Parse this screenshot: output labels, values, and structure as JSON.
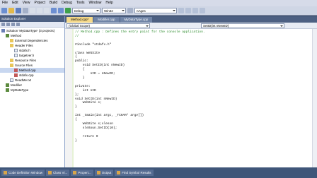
{
  "menu": [
    "File",
    "Edit",
    "View",
    "Project",
    "Build",
    "Debug",
    "Tools",
    "Window",
    "Help"
  ],
  "toolbar": {
    "config": "Debug",
    "platform": "Win32",
    "find": "nAges"
  },
  "solution_explorer": {
    "title": "Solution Explorer",
    "items": [
      {
        "label": "Solution 'MyDataType' (3 projects)",
        "kind": "sol",
        "indent": 0
      },
      {
        "label": "Method",
        "kind": "proj",
        "indent": 1
      },
      {
        "label": "External Dependencies",
        "kind": "folder",
        "indent": 2
      },
      {
        "label": "Header Files",
        "kind": "folder",
        "indent": 2
      },
      {
        "label": "stdafx.h",
        "kind": "file",
        "indent": 3
      },
      {
        "label": "targetver.h",
        "kind": "file",
        "indent": 3
      },
      {
        "label": "Resource Files",
        "kind": "folder",
        "indent": 2
      },
      {
        "label": "Source Files",
        "kind": "folder",
        "indent": 2
      },
      {
        "label": "Method.cpp",
        "kind": "cpp",
        "indent": 3
      },
      {
        "label": "stdafx.cpp",
        "kind": "cpp",
        "indent": 3
      },
      {
        "label": "ReadMe.txt",
        "kind": "file",
        "indent": 2
      },
      {
        "label": "Modifier",
        "kind": "proj",
        "indent": 1
      },
      {
        "label": "MyDataType",
        "kind": "proj",
        "indent": 1
      }
    ]
  },
  "tabs": [
    "Method.cpp*",
    "Modifier.cpp",
    "MyDataType.cpp"
  ],
  "nav": {
    "scope": "(Global Scope)",
    "member": "SetID(int nNewID)"
  },
  "code": [
    "// Method.cpp : Defines the entry point for the console application.",
    "//",
    "",
    "#include \"stdafx.h\"",
    "",
    "class WebSite",
    "{",
    "public:",
    "    void SetID(int nNewID)",
    "    {",
    "        nID = nNewID;",
    "    }",
    "",
    "private:",
    "    int nID",
    "};",
    "void SetID(int nNewID)",
    "    WebSite s;",
    "}",
    "",
    "int _tmain(int argc, _TCHAR* argv[])",
    "{",
    "    WebSite s;sleson",
    "    sleSoun.SetID(10);",
    "",
    "    return 0",
    "}"
  ],
  "status_tabs": [
    "Code Definition Window",
    "Class Vi...",
    "Propert...",
    "Output",
    "Find Symbol Results"
  ]
}
